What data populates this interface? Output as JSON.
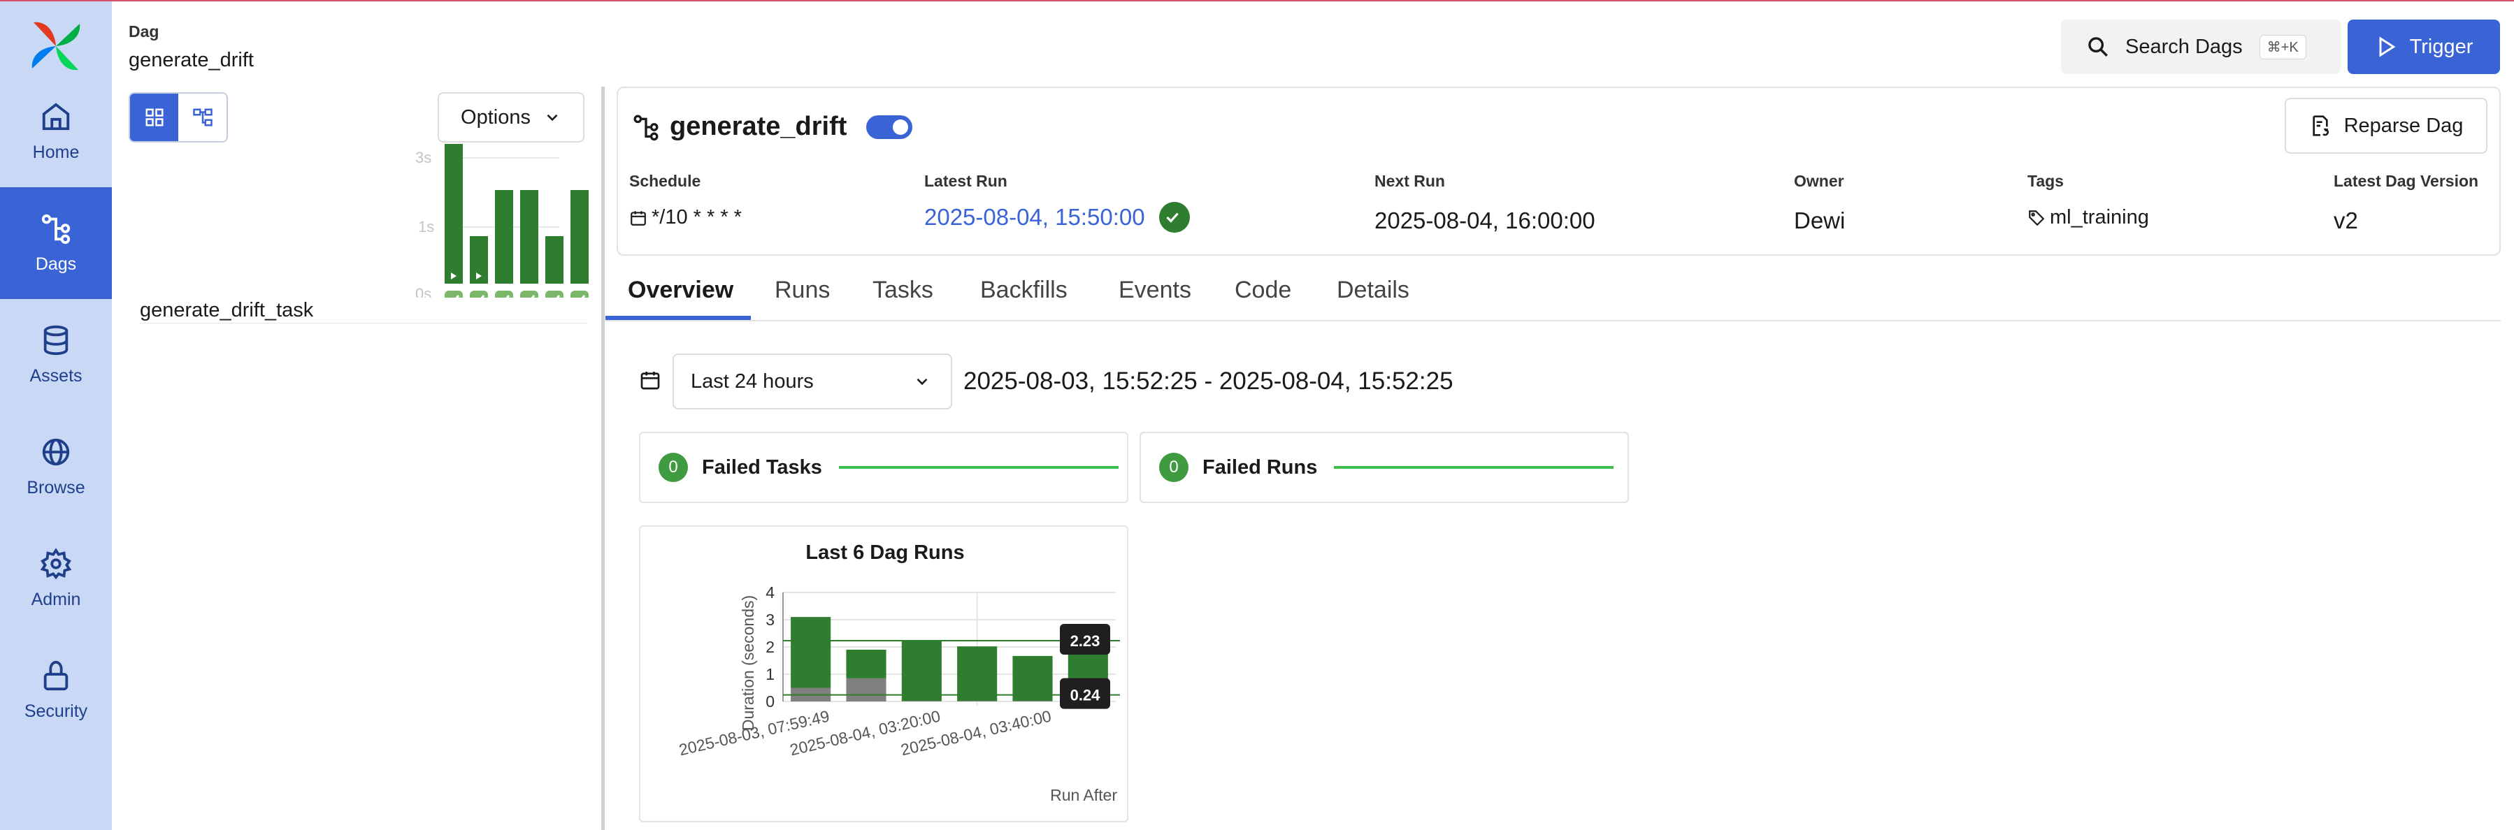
{
  "nav": {
    "items": [
      {
        "label": "Home",
        "icon": "home-icon",
        "active": false
      },
      {
        "label": "Dags",
        "icon": "dags-icon",
        "active": true
      },
      {
        "label": "Assets",
        "icon": "database-icon",
        "active": false
      },
      {
        "label": "Browse",
        "icon": "globe-icon",
        "active": false
      },
      {
        "label": "Admin",
        "icon": "gear-icon",
        "active": false
      },
      {
        "label": "Security",
        "icon": "lock-icon",
        "active": false
      }
    ]
  },
  "header": {
    "breadcrumb_label": "Dag",
    "breadcrumb_title": "generate_drift",
    "search_label": "Search Dags",
    "search_shortcut": "⌘+K",
    "trigger_label": "Trigger"
  },
  "grid": {
    "options_label": "Options",
    "axis_ticks": [
      "3s",
      "1s",
      "0s"
    ],
    "task_name": "generate_drift_task",
    "run_bar_fractions": [
      1.0,
      0.34,
      0.67,
      0.67,
      0.34,
      0.67
    ],
    "colors": {
      "bar": "#2f7d2f",
      "success": "#7cb869"
    }
  },
  "dag": {
    "title": "generate_drift",
    "paused": false,
    "reparse_label": "Reparse Dag",
    "schedule_label": "Schedule",
    "schedule_value": "*/10 * * * *",
    "latest_run_label": "Latest Run",
    "latest_run_value": "2025-08-04, 15:50:00",
    "next_run_label": "Next Run",
    "next_run_value": "2025-08-04, 16:00:00",
    "owner_label": "Owner",
    "owner_value": "Dewi",
    "tags_label": "Tags",
    "tags_value": "ml_training",
    "version_label": "Latest Dag Version",
    "version_value": "v2"
  },
  "tabs": [
    "Overview",
    "Runs",
    "Tasks",
    "Backfills",
    "Events",
    "Code",
    "Details"
  ],
  "overview": {
    "range_select": "Last 24 hours",
    "range_text": "2025-08-03, 15:52:25 - 2025-08-04, 15:52:25",
    "failed_tasks": {
      "count": "0",
      "label": "Failed Tasks"
    },
    "failed_runs": {
      "count": "0",
      "label": "Failed Runs"
    }
  },
  "chart_data": {
    "type": "bar",
    "title": "Last 6 Dag Runs",
    "ylabel": "Duration (seconds)",
    "xlabel": "Run After",
    "ylim": [
      0,
      4
    ],
    "yticks": [
      0,
      1,
      2,
      3,
      4
    ],
    "xtick_labels": [
      "2025-08-03, 07:59:49",
      "2025-08-04, 03:20:00",
      "2025-08-04, 03:40:00"
    ],
    "xtick_positions": [
      0,
      2,
      4
    ],
    "series": [
      {
        "values": [
          0.5,
          0.85,
          0.02,
          0.02,
          0.02,
          0.24
        ],
        "color": "#808080"
      },
      {
        "values": [
          2.6,
          1.05,
          2.2,
          2.0,
          1.65,
          2.23
        ],
        "color": "#2f7d2f"
      }
    ],
    "reference_lines": [
      2.23,
      0.24
    ],
    "tooltips": [
      "2.23",
      "0.24"
    ],
    "grid": true
  }
}
